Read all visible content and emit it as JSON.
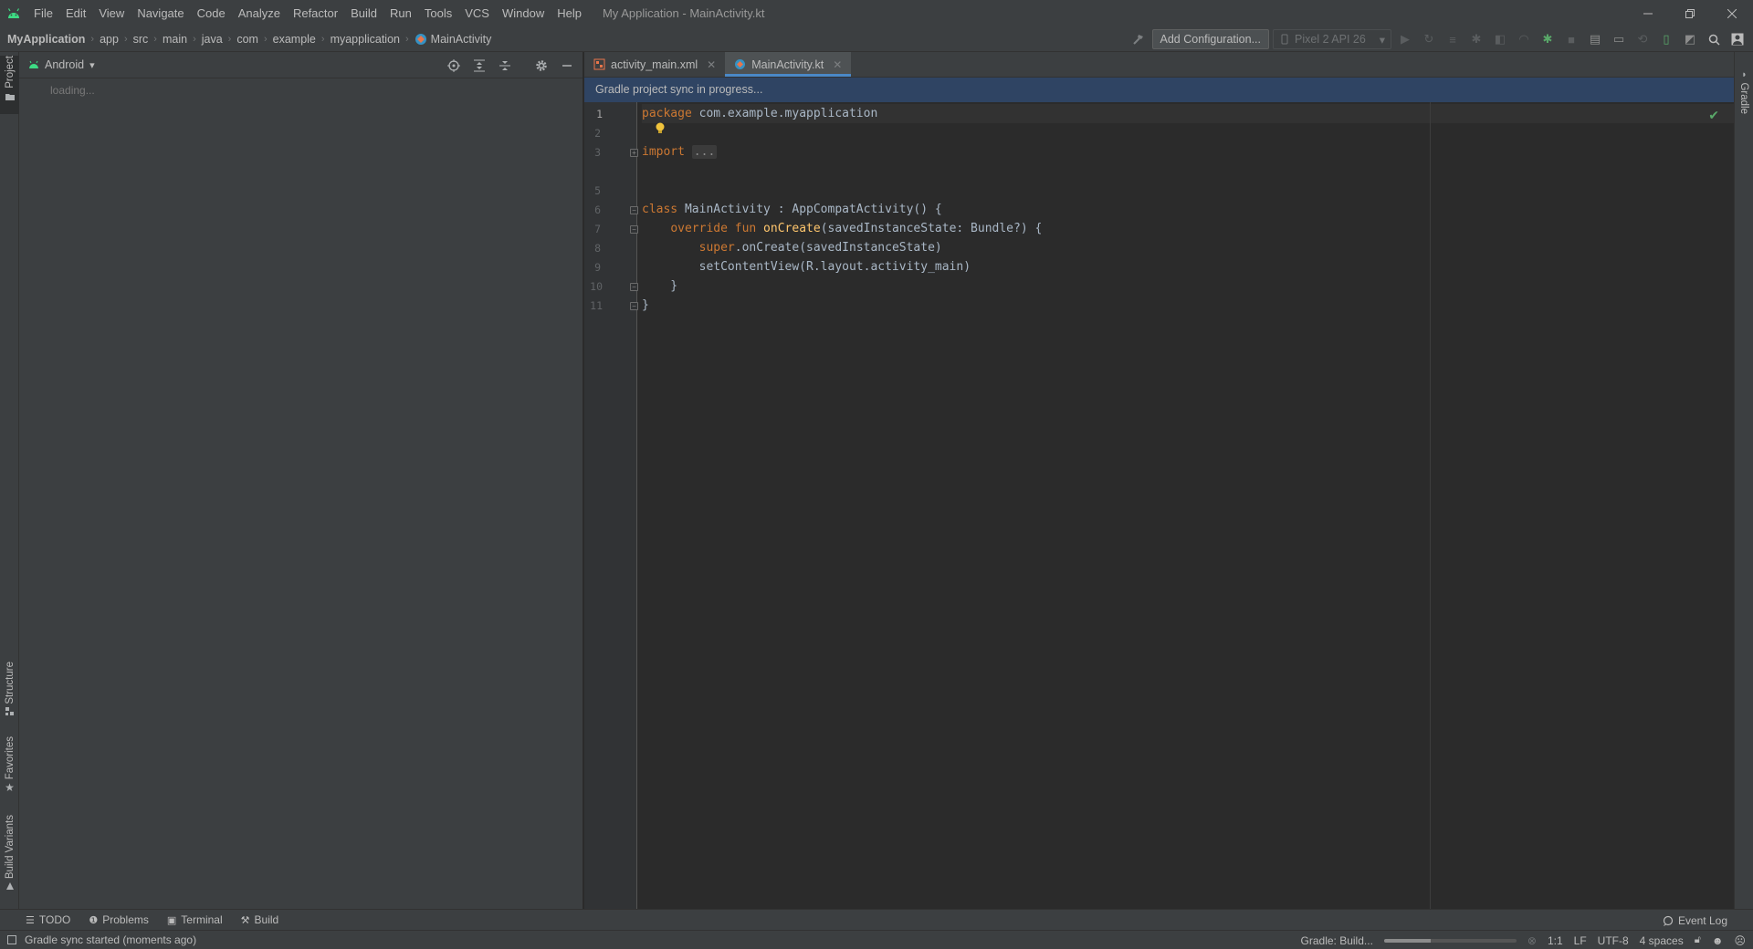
{
  "titlebar": {
    "menu": [
      "File",
      "Edit",
      "View",
      "Navigate",
      "Code",
      "Analyze",
      "Refactor",
      "Build",
      "Run",
      "Tools",
      "VCS",
      "Window",
      "Help"
    ],
    "window_title": "My Application - MainActivity.kt"
  },
  "navbar": {
    "breadcrumbs": [
      "MyApplication",
      "app",
      "src",
      "main",
      "java",
      "com",
      "example",
      "myapplication",
      "MainActivity"
    ],
    "add_config_label": "Add Configuration...",
    "device_label": "Pixel 2 API 26"
  },
  "left_strip": {
    "project_label": "Project",
    "structure_label": "Structure",
    "favorites_label": "Favorites",
    "build_variants_label": "Build Variants"
  },
  "right_strip": {
    "gradle_label": "Gradle"
  },
  "project_panel": {
    "view_mode": "Android",
    "loading_text": "loading..."
  },
  "editor": {
    "tabs": [
      {
        "label": "activity_main.xml",
        "active": false
      },
      {
        "label": "MainActivity.kt",
        "active": true
      }
    ],
    "notification": "Gradle project sync in progress...",
    "line_numbers": [
      "1",
      "2",
      "3",
      "5",
      "6",
      "7",
      "8",
      "9",
      "10",
      "11"
    ],
    "code": {
      "l1_kw": "package",
      "l1_rest": " com.example.myapplication",
      "l3_kw": "import",
      "l3_dots": "...",
      "l6_kw": "class",
      "l6_rest": " MainActivity : AppCompatActivity() {",
      "l7_indent": "    ",
      "l7_kw": "override fun",
      "l7_fn": " onCreate",
      "l7_rest": "(savedInstanceState: Bundle?) {",
      "l8_indent": "        ",
      "l8_kw": "super",
      "l8_rest": ".onCreate(savedInstanceState)",
      "l9": "        setContentView(R.layout.activity_main)",
      "l10": "    }",
      "l11": "}"
    }
  },
  "bottom_tools": {
    "items": [
      "TODO",
      "Problems",
      "Terminal",
      "Build"
    ],
    "event_log": "Event Log"
  },
  "statusbar": {
    "message": "Gradle sync started (moments ago)",
    "gradle_status": "Gradle: Build...",
    "progress": 0.35,
    "position": "1:1",
    "line_ending": "LF",
    "encoding": "UTF-8",
    "indent": "4 spaces"
  },
  "colors": {
    "accent": "#4a88c7",
    "keyword": "#cc7832",
    "function": "#ffc66d",
    "code_text": "#a9b7c6",
    "android_green": "#3ddc84"
  }
}
